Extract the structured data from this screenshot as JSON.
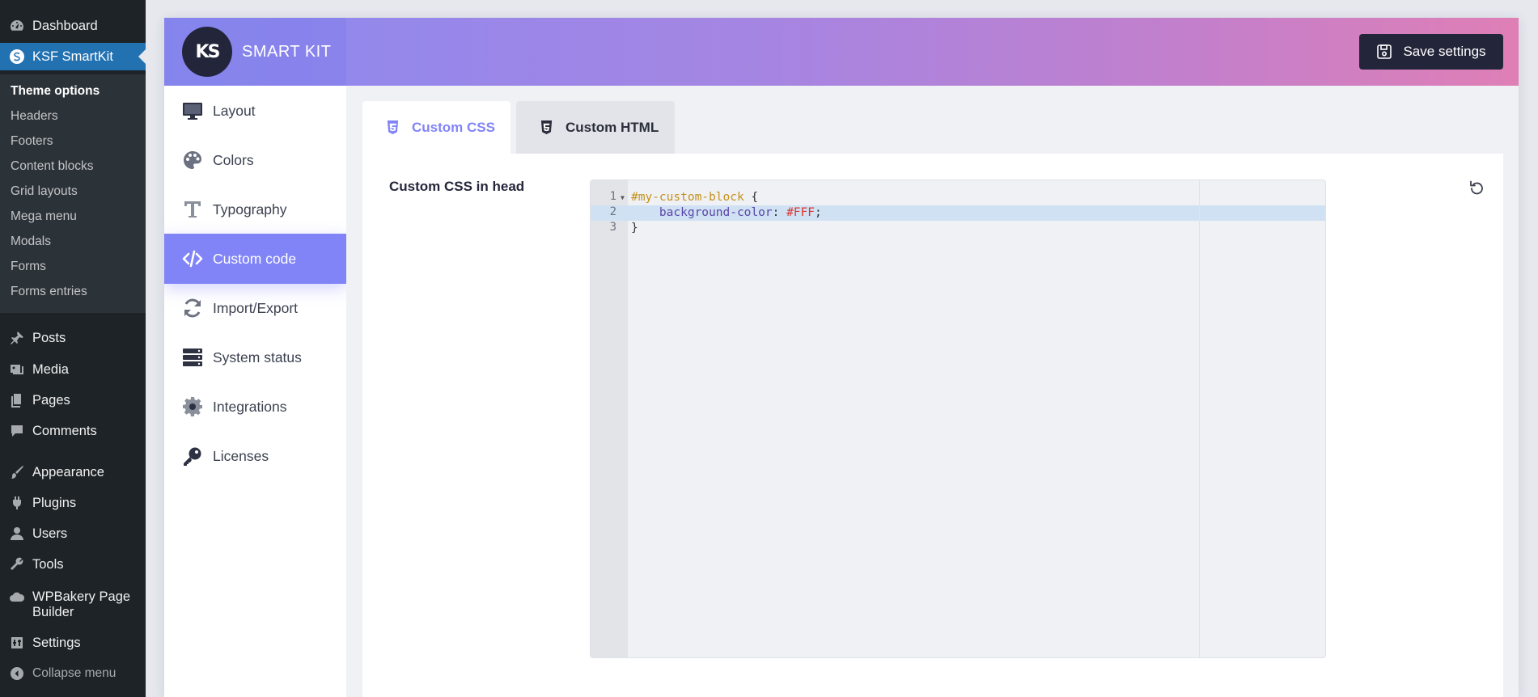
{
  "wp_menu": {
    "dashboard": "Dashboard",
    "smartkit": "KSF SmartKit",
    "submenu": [
      "Theme options",
      "Headers",
      "Footers",
      "Content blocks",
      "Grid layouts",
      "Mega menu",
      "Modals",
      "Forms",
      "Forms entries"
    ],
    "posts": "Posts",
    "media": "Media",
    "pages": "Pages",
    "comments": "Comments",
    "appearance": "Appearance",
    "plugins": "Plugins",
    "users": "Users",
    "tools": "Tools",
    "wpbakery_line1": "WPBakery Page",
    "wpbakery_line2": "Builder",
    "settings": "Settings",
    "collapse": "Collapse menu"
  },
  "header": {
    "logo_text": "KS",
    "brand": "SMART KIT",
    "save_label": "Save settings",
    "gradient_colors": [
      "#8b89f0",
      "#df7fb6"
    ]
  },
  "nav": {
    "items": [
      {
        "label": "Layout",
        "icon": "monitor-icon"
      },
      {
        "label": "Colors",
        "icon": "palette-icon"
      },
      {
        "label": "Typography",
        "icon": "typography-icon"
      },
      {
        "label": "Custom code",
        "icon": "code-icon",
        "active": true
      },
      {
        "label": "Import/Export",
        "icon": "sync-icon"
      },
      {
        "label": "System status",
        "icon": "server-icon"
      },
      {
        "label": "Integrations",
        "icon": "gear-icon"
      },
      {
        "label": "Licenses",
        "icon": "key-icon"
      }
    ],
    "accent": "#8184f7"
  },
  "tabs": {
    "css": "Custom CSS",
    "html": "Custom HTML",
    "active": "css"
  },
  "editor": {
    "label": "Custom CSS in head",
    "line_numbers": [
      "1",
      "2",
      "3"
    ],
    "selector": "#my-custom-block",
    "open_brace": " {",
    "property": "background-color",
    "colon": ": ",
    "value": "#FFF",
    "semicolon": ";",
    "close_brace": "}",
    "indent": "    ",
    "highlighted_line": 2
  }
}
